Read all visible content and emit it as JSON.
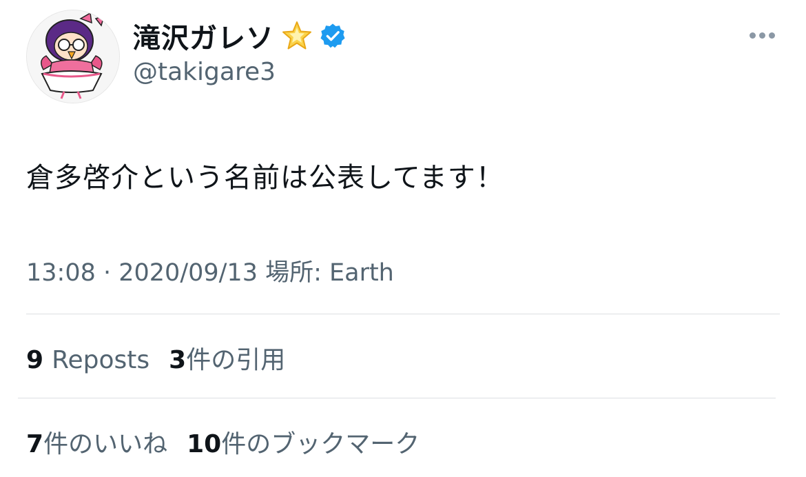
{
  "author": {
    "display_name": "滝沢ガレソ",
    "handle": "@takigare3",
    "badges": [
      "star-emoji",
      "verified-badge"
    ],
    "colors": {
      "verified": "#1d9bf0",
      "star": "#f7c531"
    }
  },
  "tweet": {
    "text": "倉多啓介という名前は公表してます！",
    "meta": "13:08 · 2020/09/13 場所: Earth"
  },
  "stats": {
    "reposts": {
      "count": "9",
      "label": "Reposts"
    },
    "quotes": {
      "count": "3",
      "label": "件の引用"
    },
    "likes": {
      "count": "7",
      "label": "件のいいね"
    },
    "bookmarks": {
      "count": "10",
      "label": "件のブックマーク"
    }
  },
  "colors": {
    "primary_text": "#0f1419",
    "secondary_text": "#536471",
    "divider": "#dcdfe2"
  }
}
